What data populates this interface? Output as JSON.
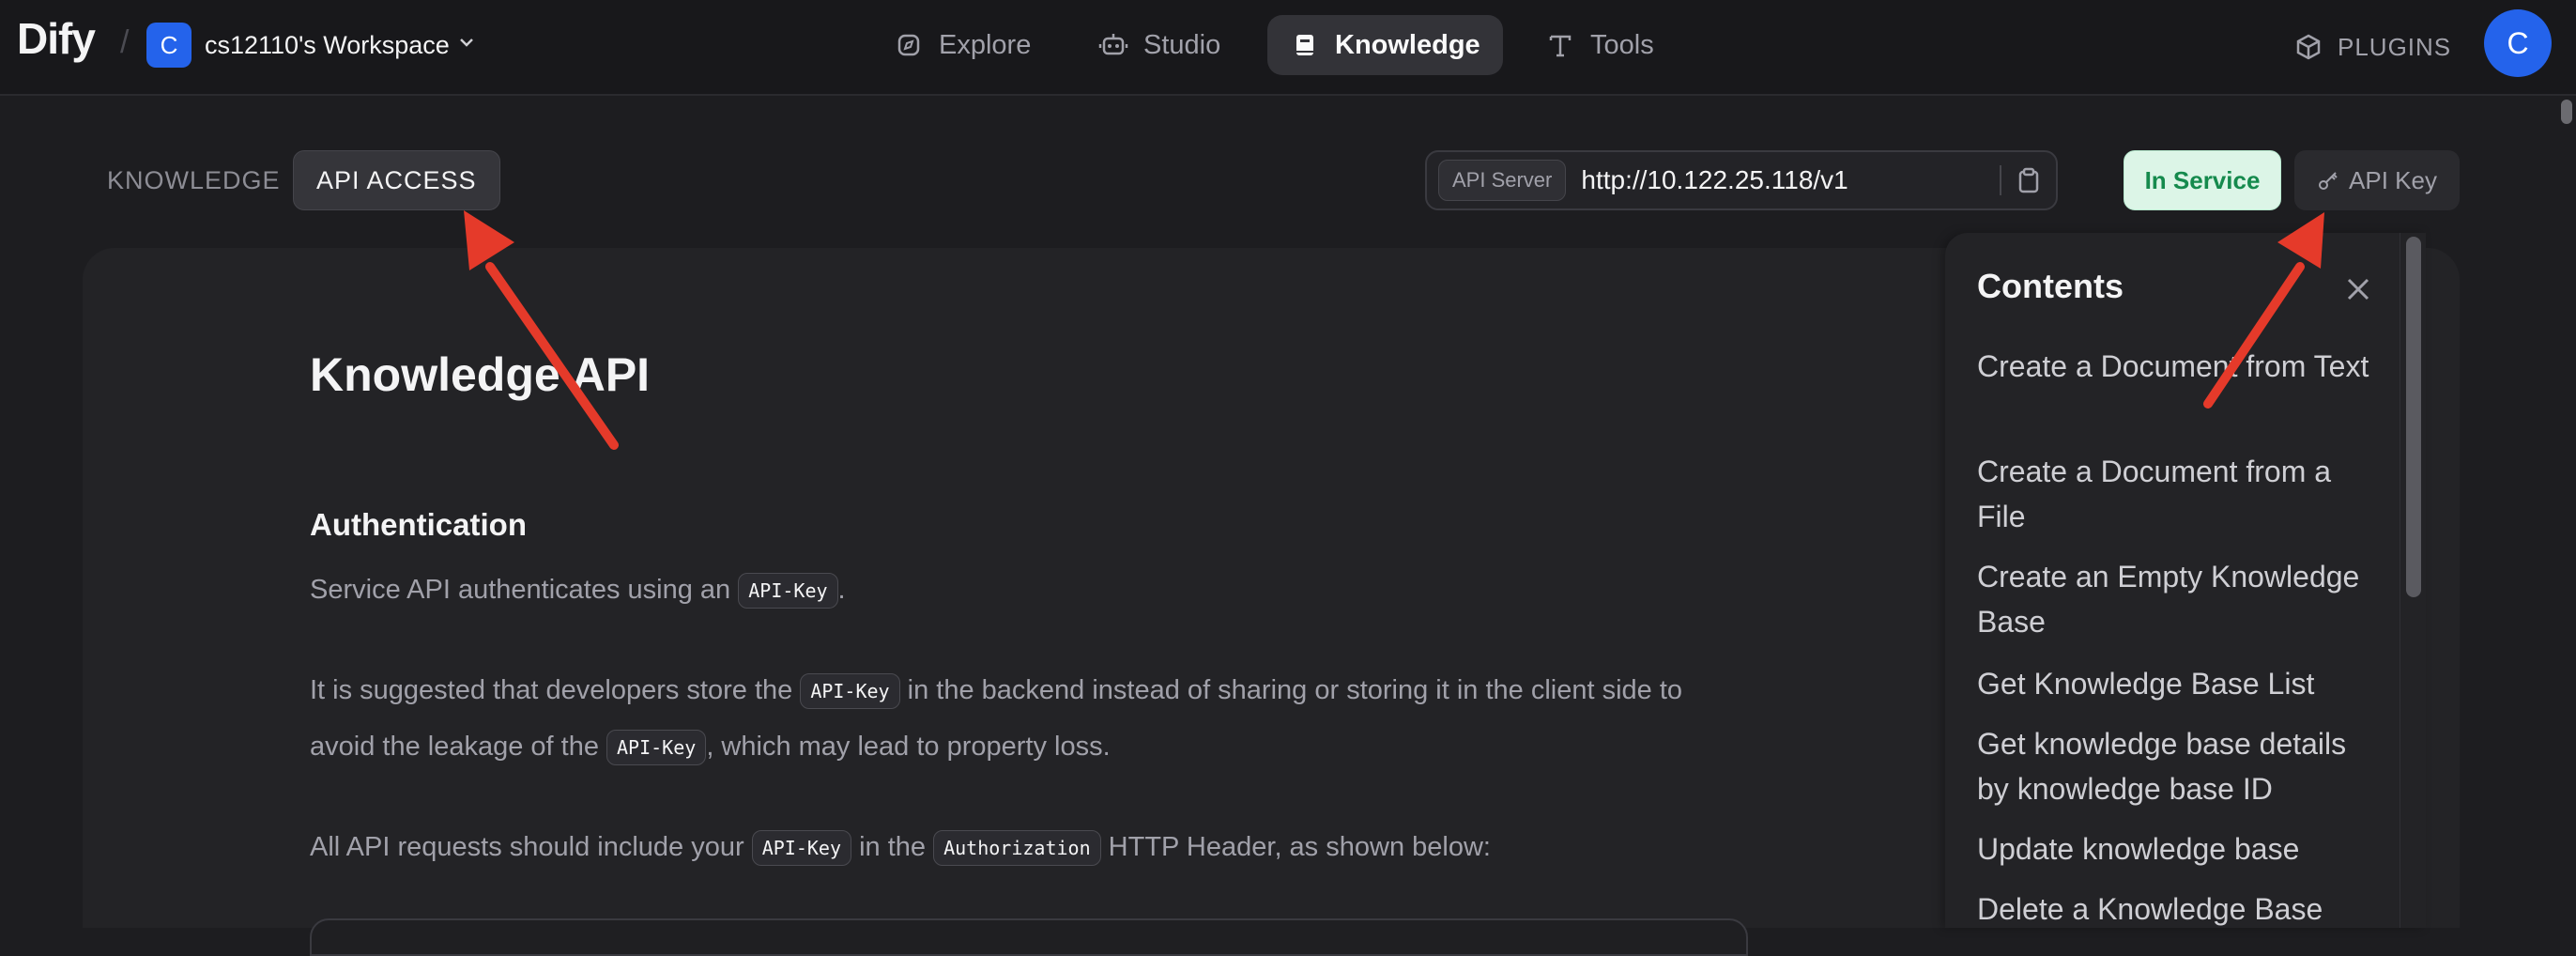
{
  "app": {
    "logo": "Dify"
  },
  "workspace": {
    "initial": "C",
    "name": "cs12110's Workspace"
  },
  "nav": {
    "explore": "Explore",
    "studio": "Studio",
    "knowledge": "Knowledge",
    "tools": "Tools",
    "plugins": "PLUGINS",
    "user_initial": "C"
  },
  "subnav": {
    "knowledge_tab": "KNOWLEDGE",
    "api_access_tab": "API ACCESS"
  },
  "api_server": {
    "tag": "API Server",
    "url": "http://10.122.25.118/v1",
    "status": "In Service",
    "api_key_label": "API Key",
    "status_bg": "#dcf5e7",
    "status_color": "#158a4d"
  },
  "doc": {
    "title": "Knowledge API",
    "section": "Authentication",
    "p1_a": "Service API authenticates using an ",
    "p1_code": "API-Key",
    "p1_b": ".",
    "p2_a": "It is suggested that developers store the ",
    "p2_code": "API-Key",
    "p2_b": " in the backend instead of sharing or storing it in the client side to",
    "p3_a": "avoid the leakage of the ",
    "p3_code": "API-Key",
    "p3_b": ", which may lead to property loss.",
    "p4_a": "All API requests should include your ",
    "p4_code1": "API-Key",
    "p4_b": " in the ",
    "p4_code2": "Authorization",
    "p4_c": " HTTP Header, as shown below:"
  },
  "contents": {
    "title": "Contents",
    "items": [
      {
        "label": "Create a Document from Text"
      },
      {
        "label": "Create a Document from a File"
      },
      {
        "label": "Create an Empty Knowledge Base"
      },
      {
        "label": "Get Knowledge Base List"
      },
      {
        "label": "Get knowledge base details by knowledge base ID"
      },
      {
        "label": "Update knowledge base"
      },
      {
        "label": "Delete a Knowledge Base"
      }
    ]
  },
  "annotation": {
    "arrow_color": "#e53a2a"
  },
  "accent": {
    "brand": "#2463eb"
  }
}
